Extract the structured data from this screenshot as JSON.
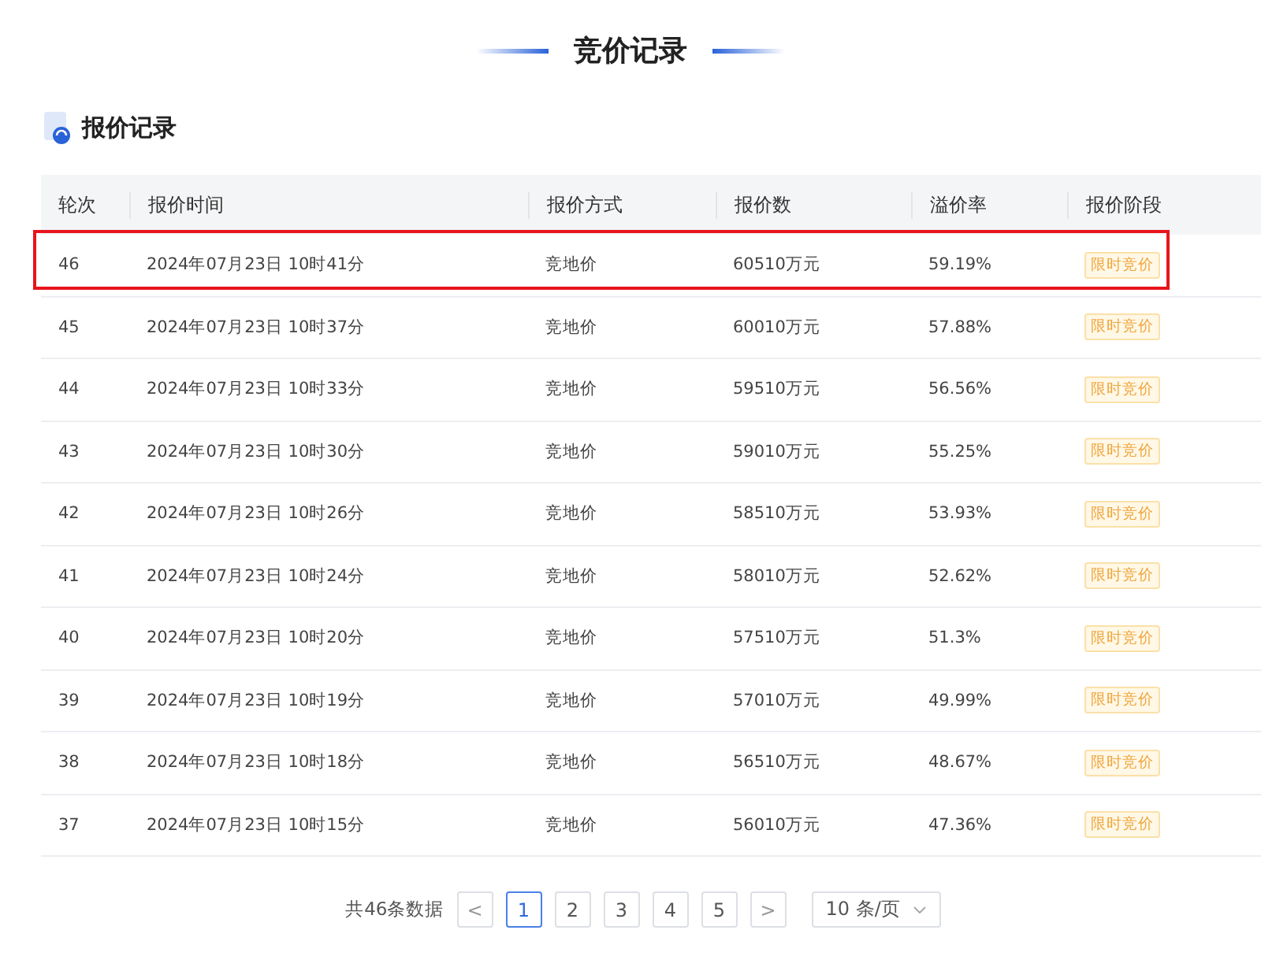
{
  "page_title": "竞价记录",
  "section": {
    "title": "报价记录"
  },
  "table": {
    "columns": [
      "轮次",
      "报价时间",
      "报价方式",
      "报价数",
      "溢价率",
      "报价阶段"
    ],
    "rows": [
      {
        "round": "46",
        "time": "2024年07月23日 10时41分",
        "method": "竞地价",
        "amount": "60510万元",
        "premium": "59.19%",
        "stage": "限时竞价",
        "highlighted": true
      },
      {
        "round": "45",
        "time": "2024年07月23日 10时37分",
        "method": "竞地价",
        "amount": "60010万元",
        "premium": "57.88%",
        "stage": "限时竞价",
        "highlighted": false
      },
      {
        "round": "44",
        "time": "2024年07月23日 10时33分",
        "method": "竞地价",
        "amount": "59510万元",
        "premium": "56.56%",
        "stage": "限时竞价",
        "highlighted": false
      },
      {
        "round": "43",
        "time": "2024年07月23日 10时30分",
        "method": "竞地价",
        "amount": "59010万元",
        "premium": "55.25%",
        "stage": "限时竞价",
        "highlighted": false
      },
      {
        "round": "42",
        "time": "2024年07月23日 10时26分",
        "method": "竞地价",
        "amount": "58510万元",
        "premium": "53.93%",
        "stage": "限时竞价",
        "highlighted": false
      },
      {
        "round": "41",
        "time": "2024年07月23日 10时24分",
        "method": "竞地价",
        "amount": "58010万元",
        "premium": "52.62%",
        "stage": "限时竞价",
        "highlighted": false
      },
      {
        "round": "40",
        "time": "2024年07月23日 10时20分",
        "method": "竞地价",
        "amount": "57510万元",
        "premium": "51.3%",
        "stage": "限时竞价",
        "highlighted": false
      },
      {
        "round": "39",
        "time": "2024年07月23日 10时19分",
        "method": "竞地价",
        "amount": "57010万元",
        "premium": "49.99%",
        "stage": "限时竞价",
        "highlighted": false
      },
      {
        "round": "38",
        "time": "2024年07月23日 10时18分",
        "method": "竞地价",
        "amount": "56510万元",
        "premium": "48.67%",
        "stage": "限时竞价",
        "highlighted": false
      },
      {
        "round": "37",
        "time": "2024年07月23日 10时15分",
        "method": "竞地价",
        "amount": "56010万元",
        "premium": "47.36%",
        "stage": "限时竞价",
        "highlighted": false
      }
    ]
  },
  "pagination": {
    "total": "共46条数据",
    "prev": "<",
    "next": ">",
    "pages": [
      {
        "label": "1",
        "selected": true
      },
      {
        "label": "2",
        "selected": false
      },
      {
        "label": "3",
        "selected": false
      },
      {
        "label": "4",
        "selected": false
      },
      {
        "label": "5",
        "selected": false
      }
    ],
    "page_size": "10 条/页"
  }
}
